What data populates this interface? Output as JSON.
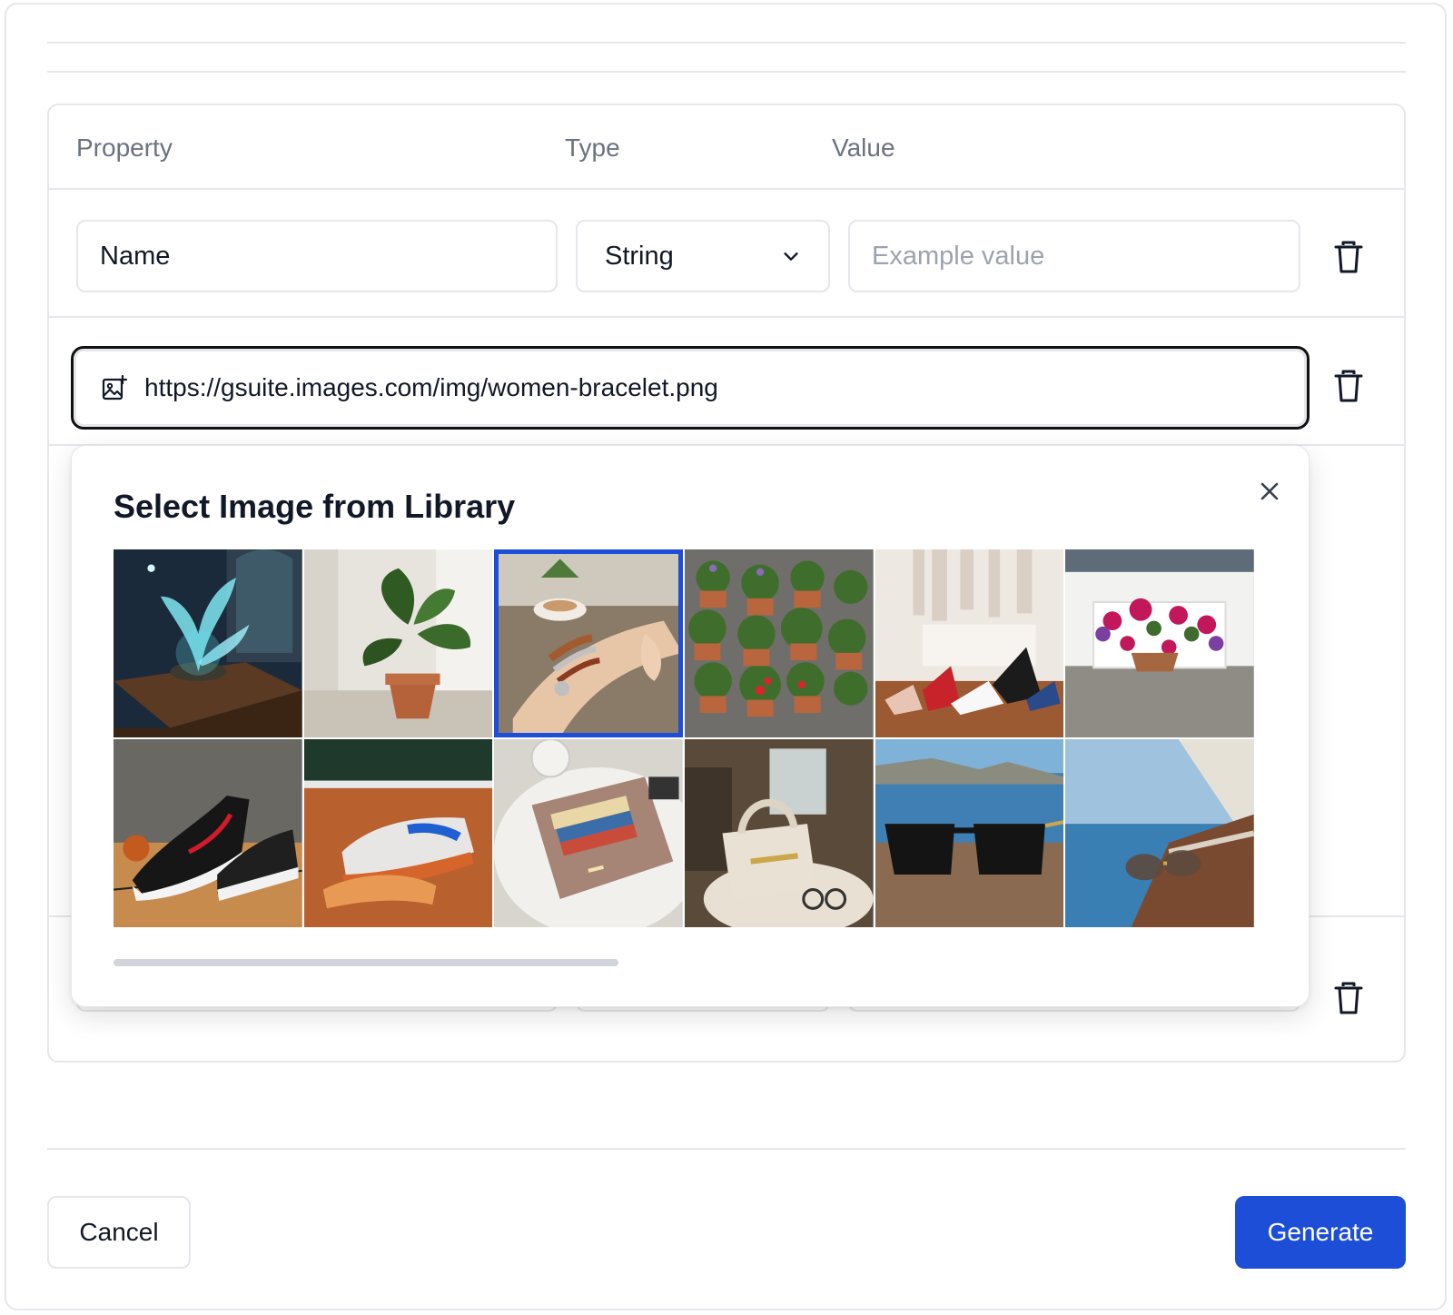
{
  "table": {
    "headers": {
      "property": "Property",
      "type": "Type",
      "value": "Value"
    },
    "row1": {
      "name_value": "Name",
      "type_value": "String",
      "value_placeholder": "Example value"
    },
    "row2": {
      "url_value": "https://gsuite.images.com/img/women-bracelet.png"
    }
  },
  "image_library": {
    "title": "Select Image from Library",
    "images": [
      {
        "name": "glowing-plant-fantasy"
      },
      {
        "name": "monstera-plant-pot"
      },
      {
        "name": "women-bracelet",
        "selected": true
      },
      {
        "name": "vertical-flower-pots-wall"
      },
      {
        "name": "shoes-closet"
      },
      {
        "name": "flower-planter-box"
      },
      {
        "name": "basketball-sneakers"
      },
      {
        "name": "tennis-shoes-clay-court"
      },
      {
        "name": "leather-wallet"
      },
      {
        "name": "handbag-chair"
      },
      {
        "name": "sunglasses-sea-view"
      },
      {
        "name": "sunglasses-yacht-deck"
      }
    ],
    "scroll_fraction": 0.44
  },
  "footer": {
    "cancel_label": "Cancel",
    "generate_label": "Generate"
  },
  "colors": {
    "accent": "#1d4ed8",
    "border": "#e5e7eb",
    "muted_text": "#6b7280"
  }
}
